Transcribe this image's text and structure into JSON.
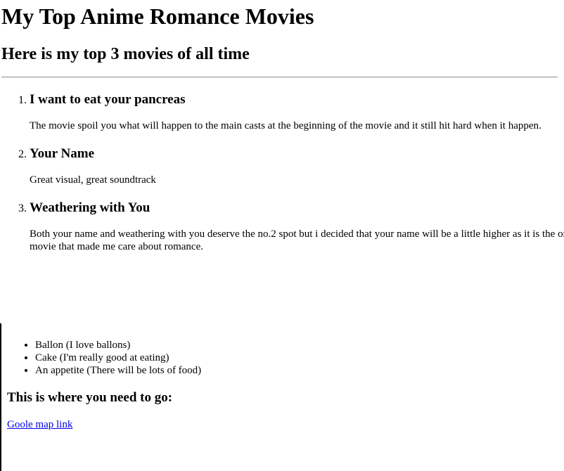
{
  "header": {
    "title": "My Top Anime Romance Movies",
    "subtitle": "Here is my top 3 movies of all time"
  },
  "movies": [
    {
      "title": "I want to eat your pancreas",
      "description": "The movie spoil you what will happen to the main casts at the beginning of the movie and it still hit hard when it happen."
    },
    {
      "title": "Your Name",
      "description": "Great visual, great soundtrack"
    },
    {
      "title": "Weathering with You",
      "description": "Both your name and weathering with you deserve the no.2 spot but i decided that your name will be a little higher as it is the one movie that made me care about romance."
    }
  ],
  "bring": {
    "items": [
      "Ballon (I love ballons)",
      "Cake (I'm really good at eating)",
      "An appetite (There will be lots of food)"
    ]
  },
  "directions": {
    "heading": "This is where you need to go:",
    "link_text": "Goole map link"
  }
}
